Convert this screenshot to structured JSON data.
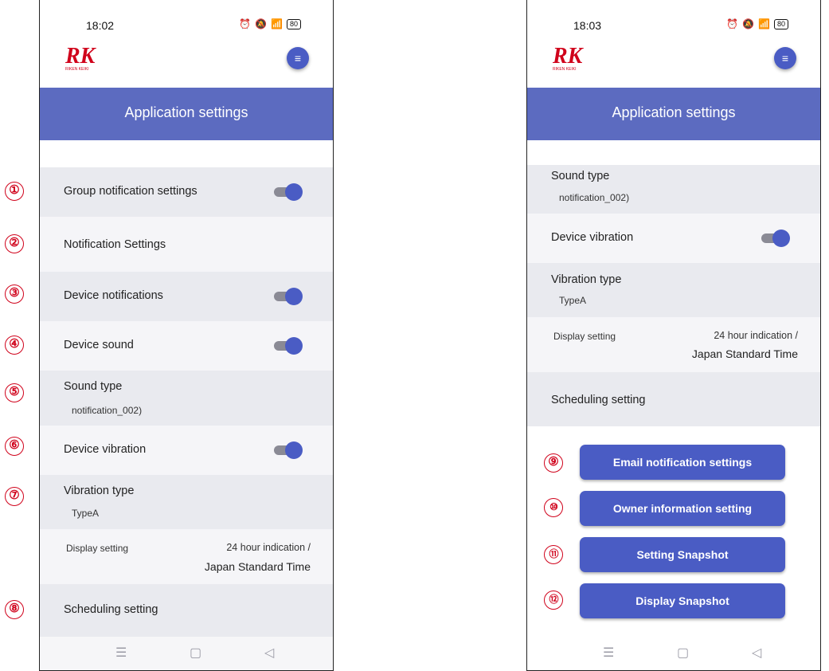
{
  "colors": {
    "accent": "#5c6bc0",
    "button": "#4a5cc4",
    "marker": "#d0021b"
  },
  "left": {
    "status_time": "18:02",
    "battery": "80",
    "logo_text": "RIKEN KEIKI",
    "header_title": "Application settings",
    "rows": {
      "group_notification": "Group notification settings",
      "notification_settings": "Notification Settings",
      "device_notifications": "Device notifications",
      "device_sound": "Device sound",
      "sound_type": "Sound type",
      "sound_type_value": "notification_002)",
      "device_vibration": "Device vibration",
      "vibration_type": "Vibration type",
      "vibration_type_value": "TypeA",
      "display_setting": "Display setting",
      "display_value_1": "24 hour indication /",
      "display_value_2": "Japan Standard Time",
      "scheduling_setting": "Scheduling setting"
    },
    "toggles": {
      "group_notification": true,
      "device_notifications": true,
      "device_sound": true,
      "device_vibration": true
    }
  },
  "right": {
    "status_time": "18:03",
    "battery": "80",
    "logo_text": "RIKEN KEIKI",
    "header_title": "Application settings",
    "rows": {
      "sound_type": "Sound type",
      "sound_type_value": "notification_002)",
      "device_vibration": "Device vibration",
      "vibration_type": "Vibration type",
      "vibration_type_value": "TypeA",
      "display_setting": "Display setting",
      "display_value_1": "24 hour indication /",
      "display_value_2": "Japan Standard Time",
      "scheduling_setting": "Scheduling setting"
    },
    "buttons": {
      "email": "Email notification settings",
      "owner": "Owner information setting",
      "setting_snapshot": "Setting Snapshot",
      "display_snapshot": "Display Snapshot"
    }
  },
  "markers": [
    "①",
    "②",
    "③",
    "④",
    "⑤",
    "⑥",
    "⑦",
    "⑧",
    "⑨",
    "⑩",
    "⑪",
    "⑫"
  ],
  "nav_icons": [
    "menu-icon",
    "home-icon",
    "back-icon"
  ]
}
